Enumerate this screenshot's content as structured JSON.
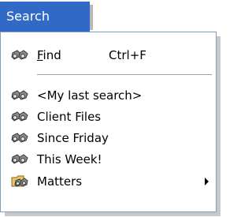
{
  "menu": {
    "title": "Search",
    "find": {
      "label_accel": "F",
      "label_rest": "ind",
      "shortcut": "Ctrl+F"
    },
    "saved_searches": [
      {
        "label": "<My last search>"
      },
      {
        "label": "Client Files"
      },
      {
        "label": "Since Friday"
      },
      {
        "label": "This Week!"
      }
    ],
    "matters": {
      "label": "Matters",
      "icon": "folder-binoculars-icon"
    }
  },
  "colors": {
    "header_bg": "#3169c6",
    "header_text": "#ffffff",
    "panel_border": "#7f9db9",
    "separator": "#a0a0a0"
  }
}
